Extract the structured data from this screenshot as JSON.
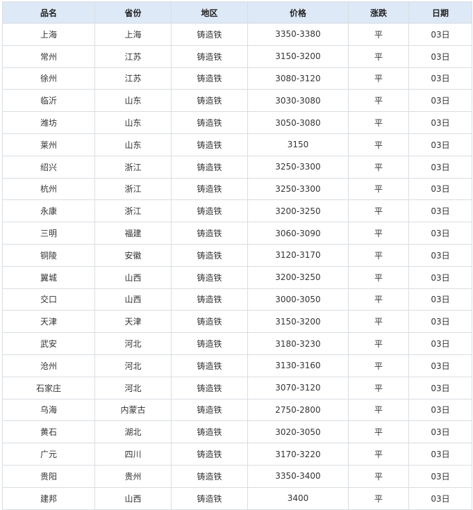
{
  "table": {
    "headers": [
      "品名",
      "省份",
      "地区",
      "价格",
      "涨跌",
      "日期"
    ],
    "rows": [
      [
        "上海",
        "上海",
        "铸造铁",
        "3350-3380",
        "平",
        "03日"
      ],
      [
        "常州",
        "江苏",
        "铸造铁",
        "3150-3200",
        "平",
        "03日"
      ],
      [
        "徐州",
        "江苏",
        "铸造铁",
        "3080-3120",
        "平",
        "03日"
      ],
      [
        "临沂",
        "山东",
        "铸造铁",
        "3030-3080",
        "平",
        "03日"
      ],
      [
        "潍坊",
        "山东",
        "铸造铁",
        "3050-3080",
        "平",
        "03日"
      ],
      [
        "莱州",
        "山东",
        "铸造铁",
        "3150",
        "平",
        "03日"
      ],
      [
        "绍兴",
        "浙江",
        "铸造铁",
        "3250-3300",
        "平",
        "03日"
      ],
      [
        "杭州",
        "浙江",
        "铸造铁",
        "3250-3300",
        "平",
        "03日"
      ],
      [
        "永康",
        "浙江",
        "铸造铁",
        "3200-3250",
        "平",
        "03日"
      ],
      [
        "三明",
        "福建",
        "铸造铁",
        "3060-3090",
        "平",
        "03日"
      ],
      [
        "铜陵",
        "安徽",
        "铸造铁",
        "3120-3170",
        "平",
        "03日"
      ],
      [
        "翼城",
        "山西",
        "铸造铁",
        "3200-3250",
        "平",
        "03日"
      ],
      [
        "交口",
        "山西",
        "铸造铁",
        "3000-3050",
        "平",
        "03日"
      ],
      [
        "天津",
        "天津",
        "铸造铁",
        "3150-3200",
        "平",
        "03日"
      ],
      [
        "武安",
        "河北",
        "铸造铁",
        "3180-3230",
        "平",
        "03日"
      ],
      [
        "沧州",
        "河北",
        "铸造铁",
        "3130-3160",
        "平",
        "03日"
      ],
      [
        "石家庄",
        "河北",
        "铸造铁",
        "3070-3120",
        "平",
        "03日"
      ],
      [
        "乌海",
        "内蒙古",
        "铸造铁",
        "2750-2800",
        "平",
        "03日"
      ],
      [
        "黄石",
        "湖北",
        "铸造铁",
        "3020-3050",
        "平",
        "03日"
      ],
      [
        "广元",
        "四川",
        "铸造铁",
        "3170-3220",
        "平",
        "03日"
      ],
      [
        "贵阳",
        "贵州",
        "铸造铁",
        "3350-3400",
        "平",
        "03日"
      ],
      [
        "建邦",
        "山西",
        "铸造铁",
        "3400",
        "平",
        "03日"
      ]
    ]
  },
  "colors": {
    "header_bg": "#dde9f7",
    "border": "#d9dde2",
    "text": "#333333"
  }
}
